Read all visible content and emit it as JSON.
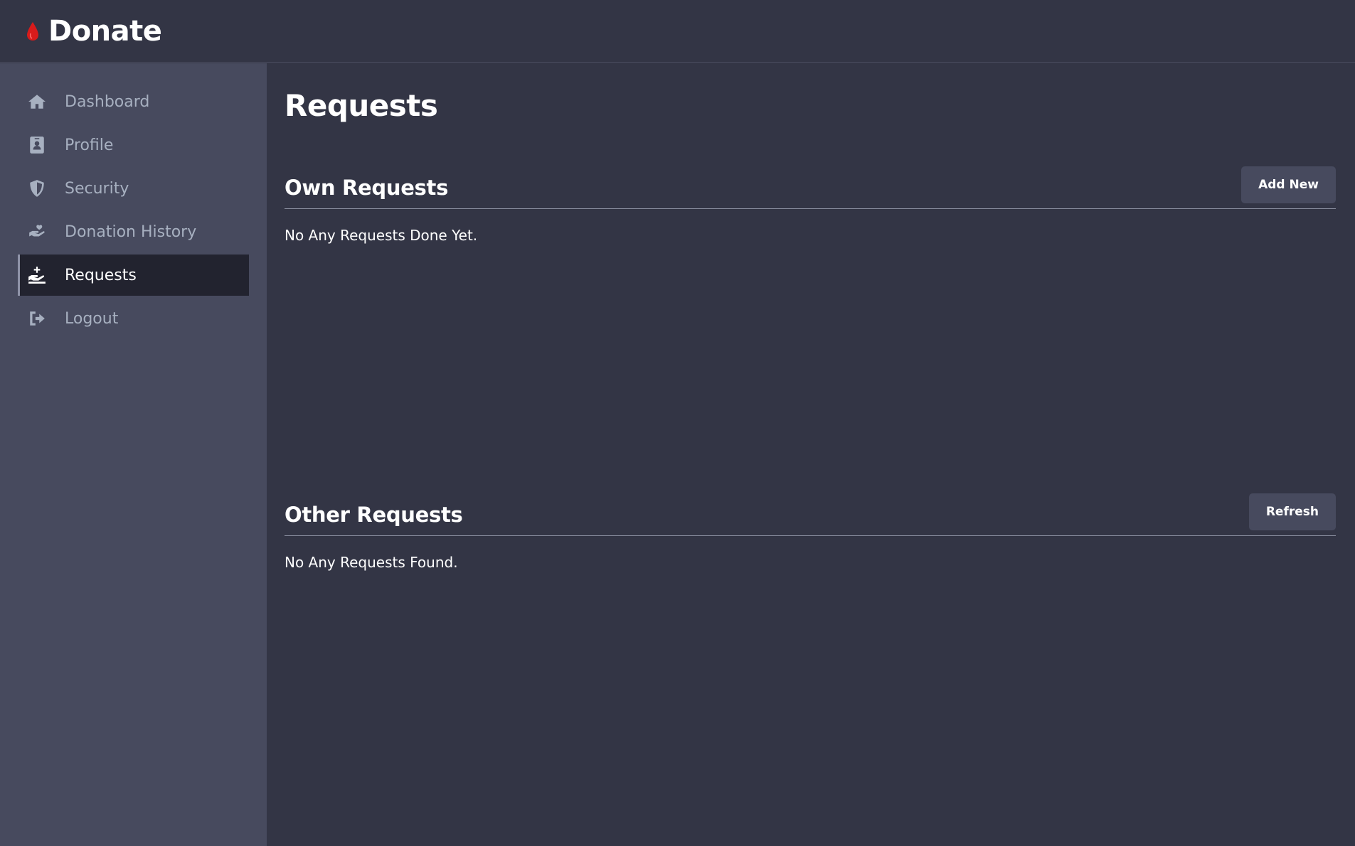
{
  "brand": {
    "name": "Donate",
    "accent": "#d81b1b"
  },
  "sidebar": {
    "items": [
      {
        "label": "Dashboard",
        "icon": "home-icon"
      },
      {
        "label": "Profile",
        "icon": "id-badge-icon"
      },
      {
        "label": "Security",
        "icon": "shield-icon"
      },
      {
        "label": "Donation History",
        "icon": "hand-holding-heart-icon"
      },
      {
        "label": "Requests",
        "icon": "hand-holding-plus-icon",
        "active": true
      },
      {
        "label": "Logout",
        "icon": "sign-out-icon"
      }
    ]
  },
  "main": {
    "title": "Requests",
    "own_requests": {
      "title": "Own Requests",
      "button_label": "Add New",
      "message": "No Any Requests Done Yet."
    },
    "other_requests": {
      "title": "Other Requests",
      "button_label": "Refresh",
      "message": "No Any Requests Found."
    }
  },
  "colors": {
    "background": "#333545",
    "sidebar": "#474a5e",
    "active_item": "#22232f",
    "nav_text": "#a7b0c0"
  }
}
